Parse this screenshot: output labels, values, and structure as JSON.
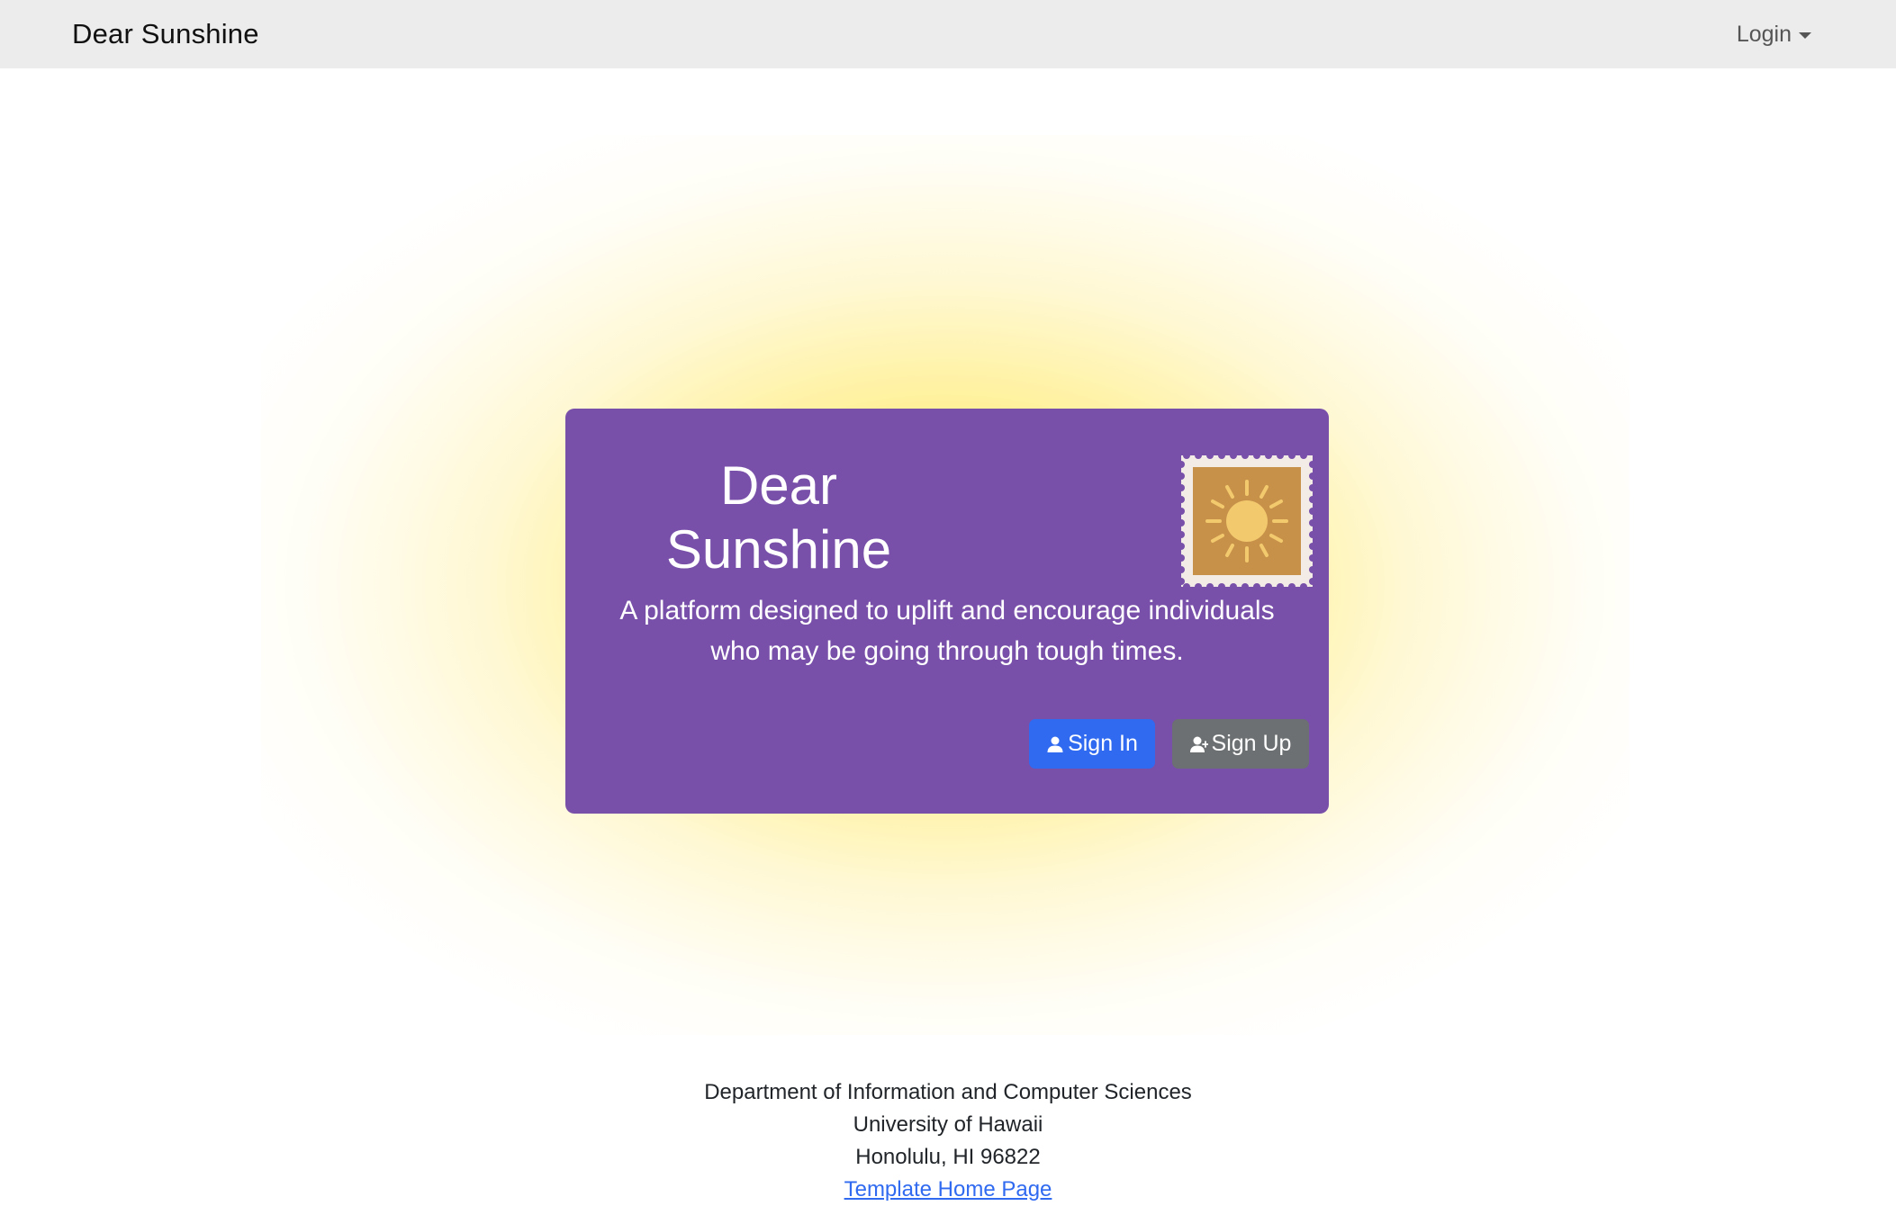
{
  "navbar": {
    "brand": "Dear Sunshine",
    "login_label": "Login"
  },
  "hero": {
    "title_line1": "Dear",
    "title_line2": "Sunshine",
    "subtitle_line1": "A platform designed to uplift and encourage individuals",
    "subtitle_line2": "who may be going through tough times.",
    "stamp_icon": "sun-stamp-icon",
    "sign_in_label": "Sign In",
    "sign_in_icon": "person-icon",
    "sign_up_label": "Sign Up",
    "sign_up_icon": "person-plus-icon"
  },
  "footer": {
    "line1": "Department of Information and Computer Sciences",
    "line2": "University of Hawaii",
    "line3": "Honolulu, HI 96822",
    "link_label": "Template Home Page"
  },
  "colors": {
    "card": "#784fa9",
    "navbar": "#ececec",
    "sign_in_button": "#2f6af0",
    "sign_up_button": "#6c7072",
    "glow": "#ffea6e",
    "stamp": "#c8914a",
    "sun": "#f2c96d"
  }
}
